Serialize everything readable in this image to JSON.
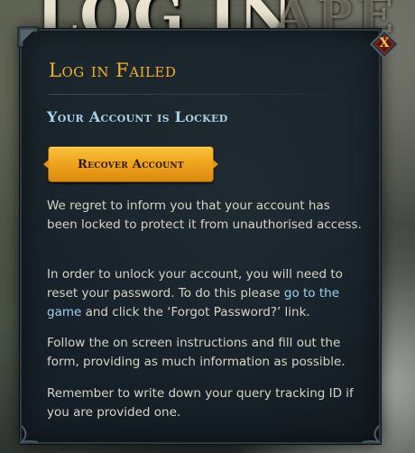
{
  "background": {
    "title_left": "LOG IN",
    "title_right": "APE"
  },
  "dialog": {
    "close_label": "X",
    "heading": "Log in Failed",
    "subheading": "Your Account is Locked",
    "recover_button_label": "Recover Account",
    "paragraphs": {
      "p1": "We regret to inform you that your account has been locked to protect it from unauthorised access.",
      "p2_before": "In order to unlock your account, you will need to reset your password. To do this please ",
      "p2_link": "go to the game",
      "p2_after": " and click the ‘Forgot Password?’ link.",
      "p3": "Follow the on screen instructions and fill out the form, providing as much information as possible.",
      "p4": "Remember to write down your query tracking ID if you are provided one."
    }
  },
  "colors": {
    "heading": "#f3b024",
    "subheading": "#a7d1e6",
    "button": "#f0a51e",
    "link": "#9fd2ee",
    "body_text": "#d8d4c4"
  }
}
